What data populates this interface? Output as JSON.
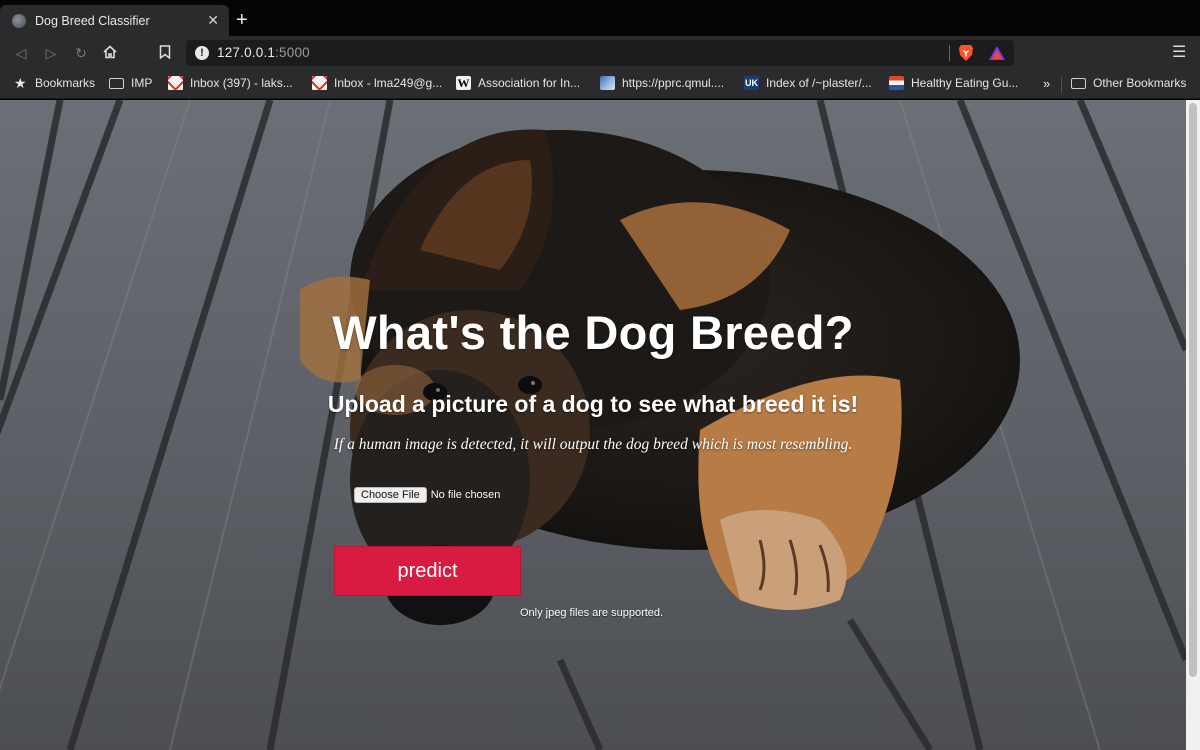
{
  "browser": {
    "tab_title": "Dog Breed Classifier",
    "tab_close": "✕",
    "new_tab": "+",
    "url_host": "127.0.0.1",
    "url_port": ":5000",
    "menu_glyph": "☰"
  },
  "nav_icons": [
    "back-icon",
    "forward-icon",
    "reload-icon",
    "home-icon",
    "bookmark-icon"
  ],
  "bookmarks": [
    {
      "label": "Bookmarks",
      "icon": "star-icon"
    },
    {
      "label": "IMP",
      "icon": "folder-icon"
    },
    {
      "label": "Inbox (397) - laks...",
      "icon": "gmail-icon"
    },
    {
      "label": "Inbox - lma249@g...",
      "icon": "gmail-icon"
    },
    {
      "label": "Association for In...",
      "icon": "wikipedia-icon"
    },
    {
      "label": "https://pprc.qmul....",
      "icon": "site-icon"
    },
    {
      "label": "Index of /~plaster/...",
      "icon": "uk-icon"
    },
    {
      "label": "Healthy Eating Gu...",
      "icon": "site-icon"
    },
    {
      "label": "Other Bookmarks",
      "icon": "folder-icon"
    }
  ],
  "overflow_chevron": "»",
  "page": {
    "title": "What's the Dog Breed?",
    "subtitle": "Upload a picture of a dog to see what breed it is!",
    "note": "If a human image is detected, it will output the dog breed which is most resembling.",
    "file_button": "Choose File",
    "file_status": "No file chosen",
    "predict_label": "predict",
    "hint": "Only jpeg files are supported."
  },
  "colors": {
    "predict_button": "#d91b42",
    "chrome": "#2b2b2d"
  }
}
